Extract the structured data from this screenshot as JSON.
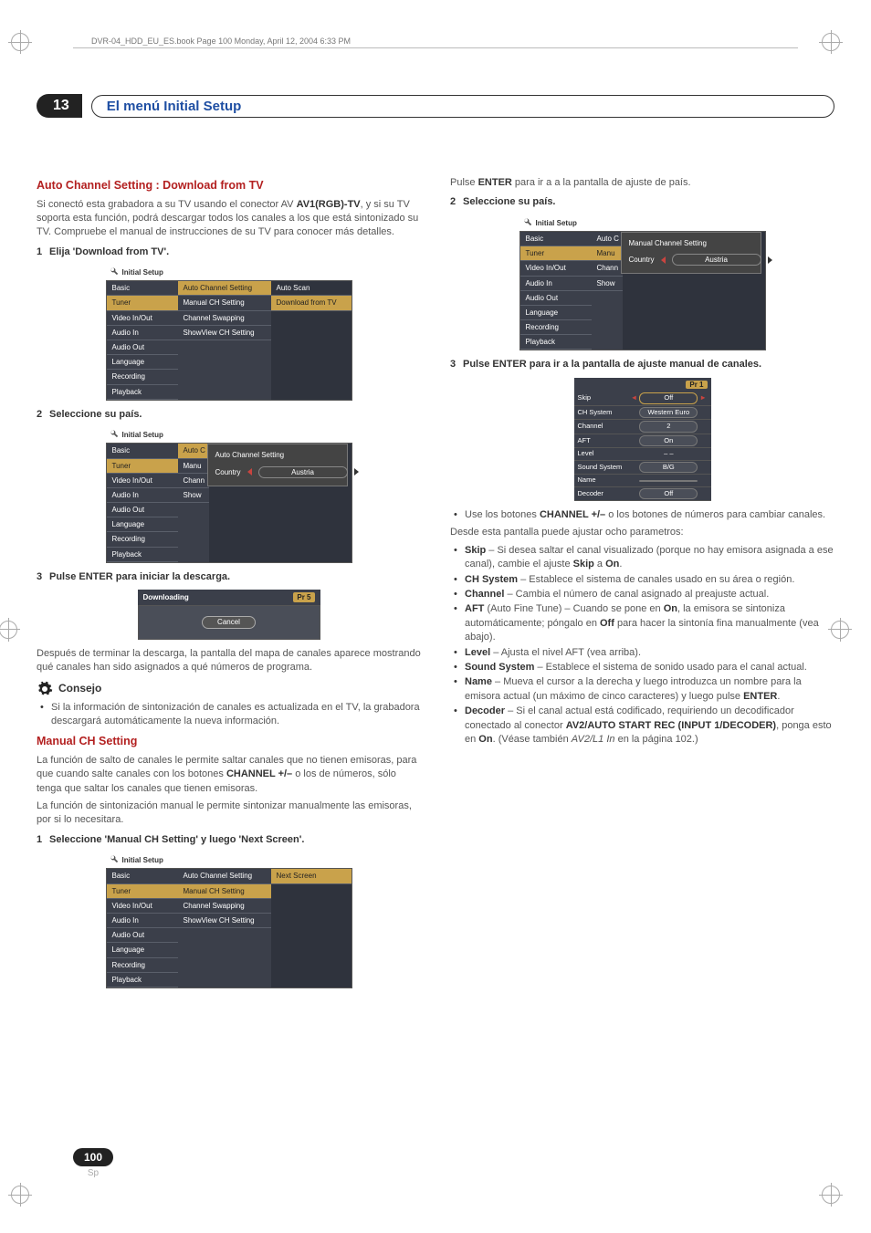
{
  "meta": {
    "bookline": "DVR-04_HDD_EU_ES.book  Page 100  Monday, April 12, 2004  6:33 PM"
  },
  "chapter": {
    "number": "13",
    "title": "El menú Initial Setup"
  },
  "left": {
    "h1": "Auto Channel Setting : Download from TV",
    "p1a": "Si conectó esta grabadora a su TV usando el conector AV ",
    "p1b": "AV1(RGB)-TV",
    "p1c": ", y si su TV soporta esta función, podrá descargar todos los canales a los que está sintonizado su TV. Compruebe el manual de instrucciones de su TV para conocer más detalles.",
    "step1": "Elija 'Download from TV'.",
    "osd1": {
      "title": "Initial Setup",
      "menu": [
        "Basic",
        "Tuner",
        "Video In/Out",
        "Audio In",
        "Audio Out",
        "Language",
        "Recording",
        "Playback"
      ],
      "sub": [
        "Auto Channel Setting",
        "Manual CH Setting",
        "Channel Swapping",
        "ShowView CH Setting"
      ],
      "area": [
        "Auto Scan",
        "Download from TV"
      ]
    },
    "step2": "Seleccione su país.",
    "osd2": {
      "title": "Initial Setup",
      "menu": [
        "Basic",
        "Tuner",
        "Video In/Out",
        "Audio In",
        "Audio Out",
        "Language",
        "Recording",
        "Playback"
      ],
      "sub_partial": [
        "Auto C",
        "Manu",
        "Chann",
        "Show"
      ],
      "overlay_title": "Auto Channel Setting",
      "overlay_label": "Country",
      "overlay_value": "Austria"
    },
    "step3": "Pulse ENTER para iniciar la descarga.",
    "dl": {
      "title": "Downloading",
      "pr": "Pr 5",
      "cancel": "Cancel"
    },
    "p2": "Después de terminar la descarga, la pantalla del mapa de canales aparece mostrando qué canales han sido asignados a qué números de programa.",
    "tip_label": "Consejo",
    "tip_text": "Si la información de sintonización de canales es actualizada en el TV, la grabadora descargará automáticamente la nueva información.",
    "h2": "Manual CH Setting",
    "mch_p1a": "La función de salto de canales le permite saltar canales que no tienen emisoras, para que cuando salte canales con los botones ",
    "mch_p1b": "CHANNEL +/–",
    "mch_p1c": " o los de números, sólo tenga que saltar los canales que tienen emisoras.",
    "mch_p2": "La función de sintonización manual le permite sintonizar manualmente las emisoras, por si lo necesitara.",
    "mch_step1": "Seleccione 'Manual CH Setting' y luego 'Next Screen'.",
    "osd3": {
      "title": "Initial Setup",
      "menu": [
        "Basic",
        "Tuner",
        "Video In/Out",
        "Audio In",
        "Audio Out",
        "Language",
        "Recording",
        "Playback"
      ],
      "sub": [
        "Auto Channel Setting",
        "Manual CH Setting",
        "Channel Swapping",
        "ShowView CH Setting"
      ],
      "area_btn": "Next Screen"
    }
  },
  "right": {
    "p1a": "Pulse ",
    "p1b": "ENTER",
    "p1c": " para ir a a la pantalla de ajuste de país.",
    "step2": "Seleccione su país.",
    "osd4": {
      "title": "Initial Setup",
      "menu": [
        "Basic",
        "Tuner",
        "Video In/Out",
        "Audio In",
        "Audio Out",
        "Language",
        "Recording",
        "Playback"
      ],
      "sub_partial": [
        "Auto C",
        "Manu",
        "Chann",
        "Show"
      ],
      "overlay_title": "Manual Channel Setting",
      "overlay_label": "Country",
      "overlay_value": "Austria"
    },
    "step3": "Pulse ENTER para ir a la pantalla de ajuste manual de canales.",
    "pr": {
      "header": "Pr 1",
      "rows": [
        {
          "k": "Skip",
          "v": "Off",
          "sel": true
        },
        {
          "k": "CH System",
          "v": "Western Euro"
        },
        {
          "k": "Channel",
          "v": "2"
        },
        {
          "k": "AFT",
          "v": "On"
        },
        {
          "k": "Level",
          "v": "– –"
        },
        {
          "k": "Sound System",
          "v": "B/G"
        },
        {
          "k": "Name",
          "v": ""
        },
        {
          "k": "Decoder",
          "v": "Off"
        }
      ]
    },
    "ul1_a": "Use los botones ",
    "ul1_b": "CHANNEL +/–",
    "ul1_c": " o los botones de números para cambiar canales.",
    "p2": "Desde esta pantalla puede ajustar ocho parametros:",
    "params": {
      "skip_a": "Skip",
      "skip_b": " – Si desea saltar el canal visualizado (porque no hay emisora asignada a ese canal), cambie el ajuste ",
      "skip_c": "Skip",
      "skip_d": " a ",
      "skip_e": "On",
      "skip_f": ".",
      "chs_a": "CH System",
      "chs_b": " – Establece el sistema de canales usado en su área o región.",
      "ch_a": "Channel",
      "ch_b": " – Cambia el número de canal asignado al preajuste actual.",
      "aft_a": "AFT",
      "aft_b": " (Auto Fine Tune) – Cuando se pone en ",
      "aft_c": "On",
      "aft_d": ", la emisora se sintoniza automáticamente; póngalo en ",
      "aft_e": "Off",
      "aft_f": " para hacer la sintonía fina manualmente (vea abajo).",
      "lvl_a": "Level",
      "lvl_b": " – Ajusta el nivel AFT (vea arriba).",
      "ss_a": "Sound System",
      "ss_b": " – Establece el sistema de sonido usado para el canal actual.",
      "nm_a": "Name",
      "nm_b": " – Mueva el cursor a la derecha y luego introduzca un nombre para la emisora actual (un máximo de cinco caracteres) y luego pulse ",
      "nm_c": "ENTER",
      "nm_d": ".",
      "dec_a": "Decoder",
      "dec_b": " – Si el canal actual está codificado, requiriendo un decodificador conectado al conector ",
      "dec_c": "AV2/AUTO START REC (INPUT 1/DECODER)",
      "dec_d": ", ponga esto en ",
      "dec_e": "On",
      "dec_f": ". (Véase también ",
      "dec_g": "AV2/L1 In",
      "dec_h": " en la página 102.)"
    }
  },
  "page": {
    "num": "100",
    "lang": "Sp"
  }
}
